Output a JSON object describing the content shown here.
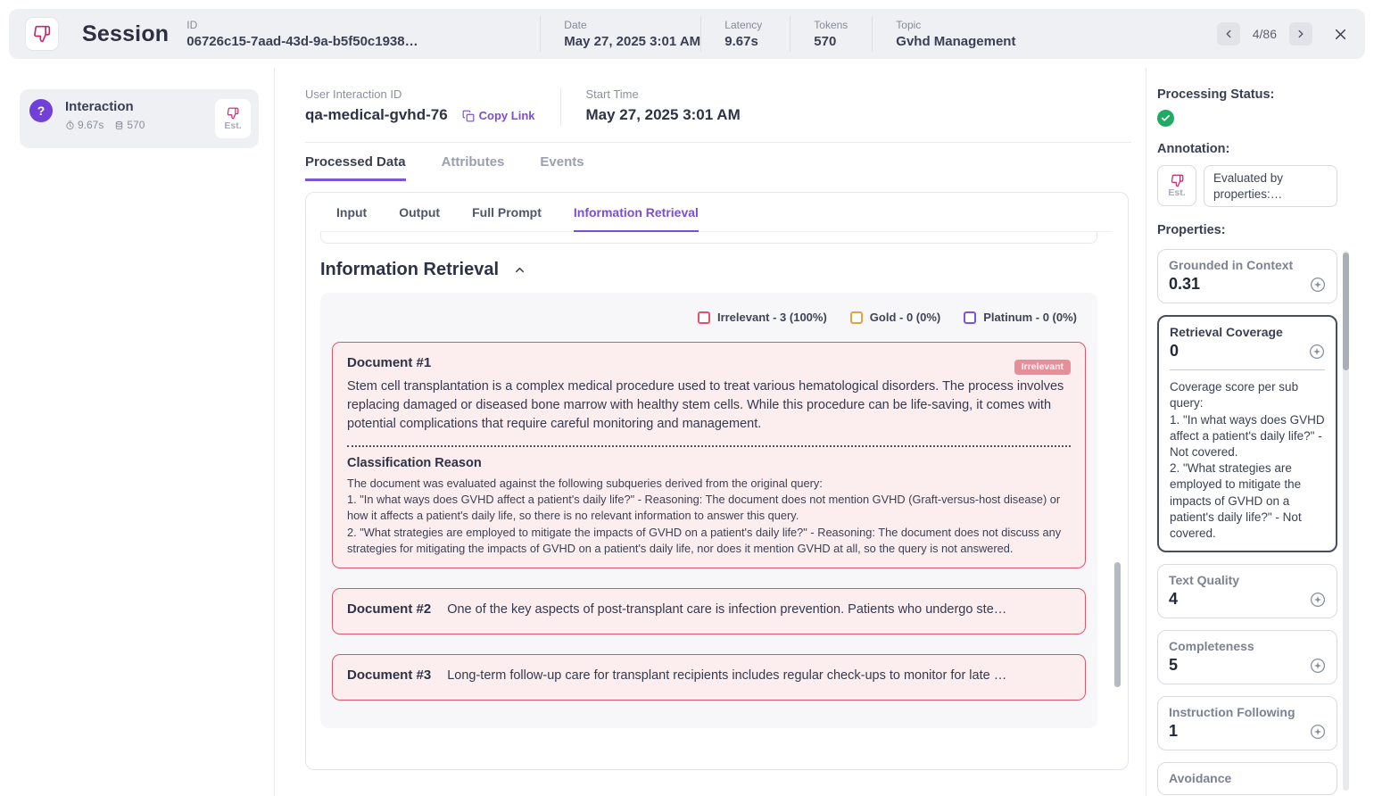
{
  "colors": {
    "accent_magenta": "#c9256d",
    "accent_purple": "#7c4fd0",
    "irrelevant_red": "#e2546b",
    "gold": "#dfa63e",
    "platinum_purple": "#7a52e8",
    "success_green": "#1fab63",
    "doc_card_bg": "#fcedef",
    "doc_card_border": "#d9596b"
  },
  "header": {
    "title": "Session",
    "fields": [
      {
        "label": "ID",
        "value": "06726c15-7aad-43d-9a-b5f50c1938…"
      },
      {
        "label": "Date",
        "value": "May 27, 2025 3:01 AM"
      },
      {
        "label": "Latency",
        "value": "9.67s"
      },
      {
        "label": "Tokens",
        "value": "570"
      },
      {
        "label": "Topic",
        "value": "Gvhd Management"
      }
    ],
    "pagination": "4/86"
  },
  "sidebar": {
    "interaction": {
      "title": "Interaction",
      "latency": "9.67s",
      "tokens": "570",
      "annotation_label": "Est."
    }
  },
  "main": {
    "user_interaction_id_label": "User Interaction ID",
    "user_interaction_id_value": "qa-medical-gvhd-76",
    "copy_link_label": "Copy Link",
    "start_time_label": "Start Time",
    "start_time_value": "May 27, 2025 3:01 AM",
    "tabs": [
      {
        "label": "Processed Data",
        "active": true
      },
      {
        "label": "Attributes",
        "active": false
      },
      {
        "label": "Events",
        "active": false
      }
    ],
    "subtabs": [
      {
        "label": "Input",
        "active": false
      },
      {
        "label": "Output",
        "active": false
      },
      {
        "label": "Full Prompt",
        "active": false
      },
      {
        "label": "Information Retrieval",
        "active": true
      }
    ],
    "section_title": "Information Retrieval",
    "legend": [
      {
        "label": "Irrelevant - 3 (100%)",
        "color": "#e2546b"
      },
      {
        "label": "Gold - 0 (0%)",
        "color": "#dfa63e"
      },
      {
        "label": "Platinum - 0 (0%)",
        "color": "#7a52e8"
      }
    ],
    "documents": [
      {
        "title": "Document #1",
        "badge": "Irrelevant",
        "body": "Stem cell transplantation is a complex medical procedure used to treat various hematological disorders. The process involves replacing damaged or diseased bone marrow with healthy stem cells. While this procedure can be life-saving, it comes with potential complications that require careful monitoring and management.",
        "classification_title": "Classification Reason",
        "classification_body": "The document was evaluated against the following subqueries derived from the original query:\n1. \"In what ways does GVHD affect a patient's daily life?\" - Reasoning: The document does not mention GVHD (Graft-versus-host disease) or how it affects a patient's daily life, so there is no relevant information to answer this query.\n2. \"What strategies are employed to mitigate the impacts of GVHD on a patient's daily life?\" - Reasoning: The document does not discuss any strategies for mitigating the impacts of GVHD on a patient's daily life, nor does it mention GVHD at all, so the query is not answered."
      },
      {
        "title": "Document #2",
        "preview": "One of the key aspects of post-transplant care is infection prevention. Patients who undergo ste…"
      },
      {
        "title": "Document #3",
        "preview": "Long-term follow-up care for transplant recipients includes regular check-ups to monitor for late …"
      }
    ]
  },
  "right_panel": {
    "processing_status_label": "Processing Status:",
    "annotation_label": "Annotation:",
    "annotation_est_label": "Est.",
    "annotation_note": "Evaluated by properties:…",
    "properties_label": "Properties:",
    "properties": [
      {
        "name": "Grounded in Context",
        "value": "0.31",
        "selected": false
      },
      {
        "name": "Retrieval Coverage",
        "value": "0",
        "selected": true,
        "description": "Coverage score per sub query:\n1. \"In what ways does GVHD affect a patient's daily life?\" - Not covered.\n2. \"What strategies are employed to mitigate the impacts of GVHD on a patient's daily life?\" - Not covered."
      },
      {
        "name": "Text Quality",
        "value": "4",
        "selected": false
      },
      {
        "name": "Completeness",
        "value": "5",
        "selected": false
      },
      {
        "name": "Instruction Following",
        "value": "1",
        "selected": false
      },
      {
        "name": "Avoidance",
        "value": "",
        "selected": false
      }
    ]
  }
}
